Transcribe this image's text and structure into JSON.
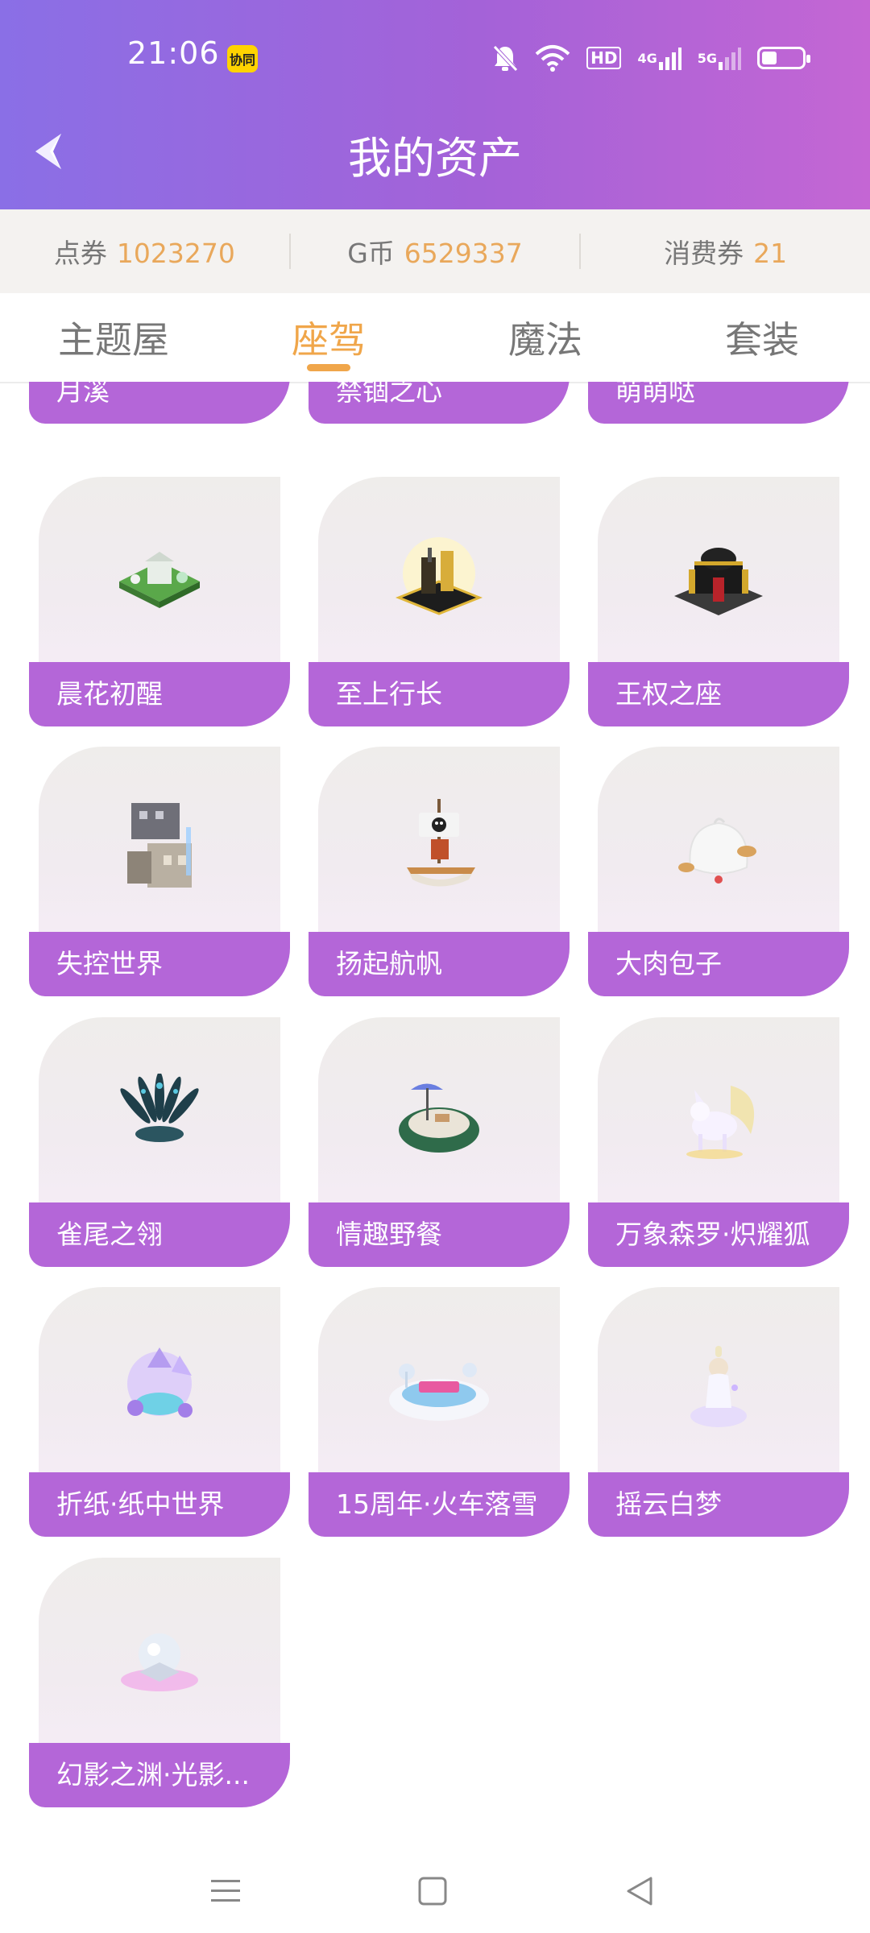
{
  "status": {
    "time": "21:06",
    "app_badge": "协同",
    "hd": "HD",
    "net1": "4G",
    "net2": "5G"
  },
  "header": {
    "title": "我的资产"
  },
  "assets": [
    {
      "name": "点券",
      "value": "1023270"
    },
    {
      "name": "G币",
      "value": "6529337"
    },
    {
      "name": "消费券",
      "value": "21"
    }
  ],
  "tabs": [
    {
      "label": "主题屋",
      "active": false
    },
    {
      "label": "座驾",
      "active": true
    },
    {
      "label": "魔法",
      "active": false
    },
    {
      "label": "套装",
      "active": false
    }
  ],
  "items": [
    {
      "name": "月溪",
      "icon": "item-art"
    },
    {
      "name": "禁锢之心",
      "icon": "item-art"
    },
    {
      "name": "萌萌哒",
      "icon": "item-art"
    },
    {
      "name": "晨花初醒",
      "icon": "garden-art"
    },
    {
      "name": "至上行长",
      "icon": "gold-mansion-art"
    },
    {
      "name": "王权之座",
      "icon": "palace-art"
    },
    {
      "name": "失控世界",
      "icon": "city-art"
    },
    {
      "name": "扬起航帆",
      "icon": "pirate-ship-art"
    },
    {
      "name": "大肉包子",
      "icon": "bun-art"
    },
    {
      "name": "雀尾之翎",
      "icon": "feather-art"
    },
    {
      "name": "情趣野餐",
      "icon": "picnic-art"
    },
    {
      "name": "万象森罗·炽耀狐",
      "icon": "fox-art"
    },
    {
      "name": "折纸·纸中世界",
      "icon": "paper-world-art"
    },
    {
      "name": "15周年·火车落雪",
      "icon": "snow-train-art"
    },
    {
      "name": "摇云白梦",
      "icon": "cloud-dream-art"
    },
    {
      "name": "幻影之渊·光影...",
      "icon": "crystal-art"
    }
  ],
  "colors": {
    "accent": "#f0a64a",
    "card_label": "#b466d8",
    "header_start": "#8a6fe6",
    "header_end": "#c466d4",
    "value": "#e9a85b"
  }
}
